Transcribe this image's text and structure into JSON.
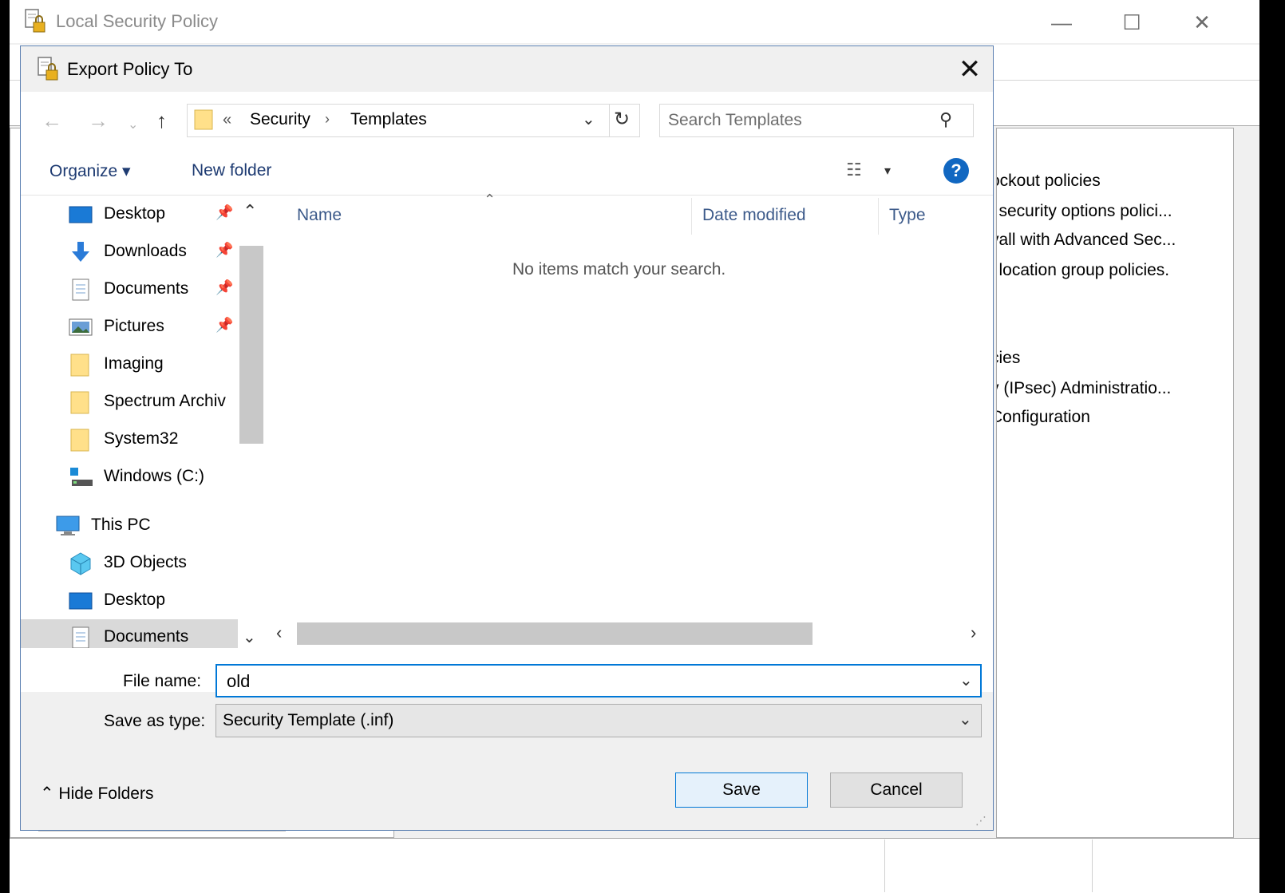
{
  "main_window": {
    "title": "Local Security Policy",
    "controls": {
      "minimize": "—",
      "maximize": "☐",
      "close": "✕"
    },
    "right_pane_lines": [
      "ockout policies",
      "l security options polici...",
      "vall with Advanced Sec...",
      "l location group policies.",
      "cies",
      "y (IPsec) Administratio...",
      "Configuration"
    ]
  },
  "dialog": {
    "title": "Export Policy To",
    "close": "✕",
    "nav": {
      "back": "←",
      "forward": "→",
      "recent": "⌄",
      "up": "↑",
      "address": {
        "overflow": "«",
        "crumbs": [
          "Security",
          "Templates"
        ],
        "separator": "›",
        "dropdown": "⌄",
        "refresh": "↻"
      },
      "search": {
        "placeholder": "Search Templates",
        "icon": "⚲"
      }
    },
    "commands": {
      "organize": "Organize ▾",
      "new_folder": "New folder",
      "view_icon": "☷",
      "view_dropdown": "▾",
      "help": "?"
    },
    "tree": {
      "scroll_up": "⌃",
      "scroll_down": "⌄",
      "pin_glyph": "📌",
      "items": [
        {
          "label": "Desktop",
          "icon": "desktop-icon",
          "pinned": true
        },
        {
          "label": "Downloads",
          "icon": "downloads-icon",
          "pinned": true
        },
        {
          "label": "Documents",
          "icon": "documents-icon",
          "pinned": true
        },
        {
          "label": "Pictures",
          "icon": "pictures-icon",
          "pinned": true
        },
        {
          "label": "Imaging",
          "icon": "folder-icon",
          "pinned": false
        },
        {
          "label": "Spectrum Archiv",
          "icon": "folder-icon",
          "pinned": false
        },
        {
          "label": "System32",
          "icon": "folder-icon",
          "pinned": false
        },
        {
          "label": "Windows (C:)",
          "icon": "drive-icon",
          "pinned": false
        },
        {
          "label": "This PC",
          "icon": "computer-icon",
          "pinned": false
        },
        {
          "label": "3D Objects",
          "icon": "3d-objects-icon",
          "pinned": false
        },
        {
          "label": "Desktop",
          "icon": "desktop-icon",
          "pinned": false
        },
        {
          "label": "Documents",
          "icon": "documents-icon",
          "pinned": false
        }
      ]
    },
    "list": {
      "sort_caret": "⌃",
      "columns": [
        "Name",
        "Date modified",
        "Type"
      ],
      "empty_message": "No items match your search.",
      "hscroll_left": "‹",
      "hscroll_right": "›"
    },
    "file_name": {
      "label": "File name:",
      "value": "old",
      "dropdown": "⌄"
    },
    "save_as_type": {
      "label": "Save as type:",
      "value": "Security Template (.inf)",
      "dropdown": "⌄"
    },
    "hide_folders": "⌃  Hide Folders",
    "buttons": {
      "save": "Save",
      "cancel": "Cancel"
    },
    "grip": "⋰"
  },
  "colors": {
    "accent": "#0078d7",
    "link": "#1e3b72",
    "help": "#1167c1",
    "folder": "#ffe08a"
  }
}
